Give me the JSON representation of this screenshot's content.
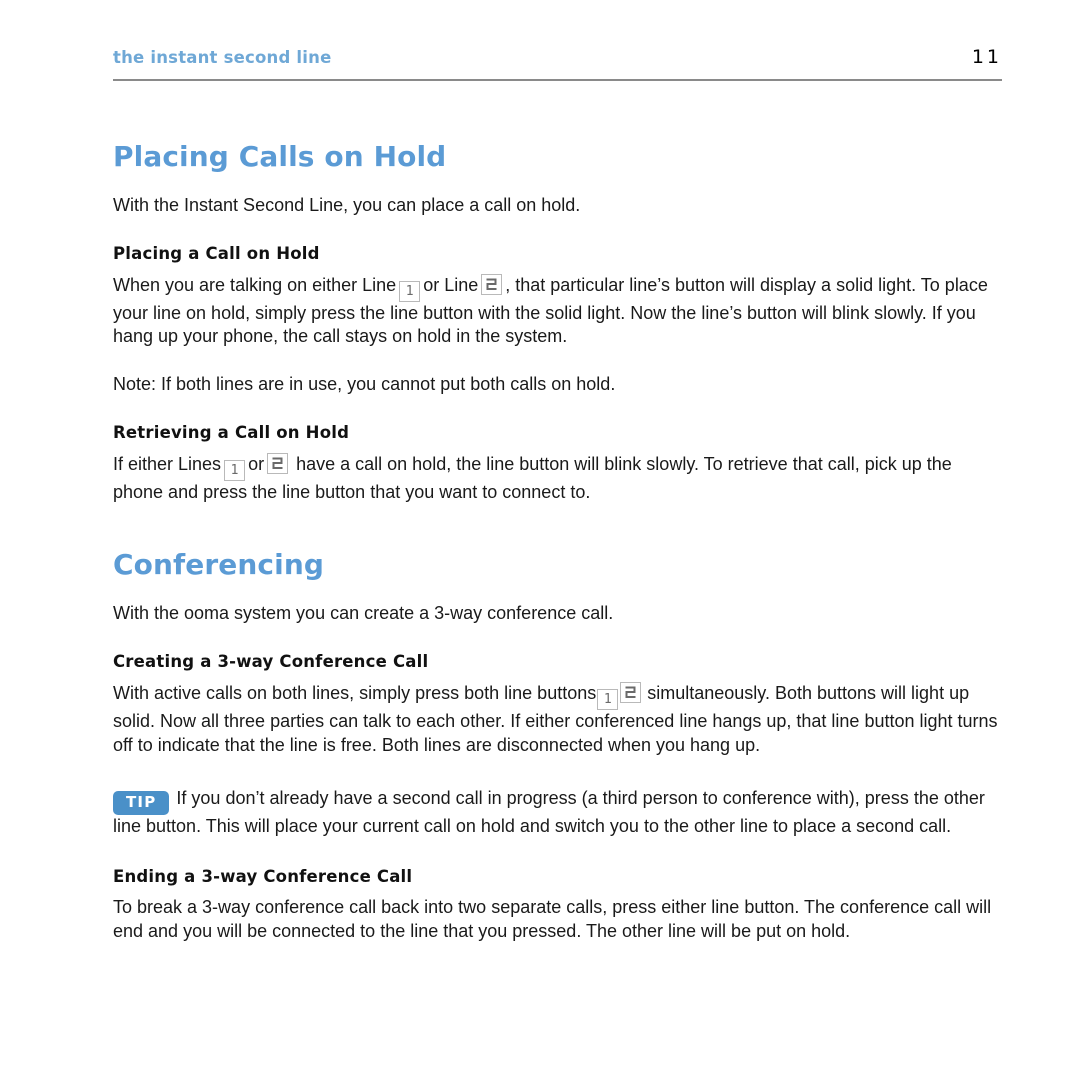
{
  "header": {
    "title": "the instant second line",
    "page_number": "11",
    "title_color": "#6fa8d6",
    "rule_color": "#8a8a8a"
  },
  "theme": {
    "heading_blue": "#5b9bd5",
    "tip_badge_blue": "#4a90c8",
    "body_black": "#1a1a1a",
    "line_button_border": "#b9b9b9",
    "line_button_digit": "#6a6a6a"
  },
  "sections": [
    {
      "title": "Placing Calls on Hold",
      "lead": "With the Instant Second Line, you can place a call on hold.",
      "subsections": [
        {
          "title": "Placing a Call on Hold",
          "para_1a": "When you are talking on either Line",
          "btn_1": "1",
          "para_1b": "or Line",
          "btn_2": "2",
          "para_1c": ", that particular line’s button will display a solid light. To place your line on hold, simply press the line button with the solid light. Now the line’s button will blink slowly. If you hang up your phone, the call stays on hold in the system.",
          "note": "Note: If both lines are in use, you cannot put both calls on hold."
        },
        {
          "title": "Retrieving a Call on Hold",
          "para_2a": "If either Lines",
          "btn_1": "1",
          "para_2b": "or",
          "btn_2": "2",
          "para_2c": "have a call on hold, the line button will blink slowly. To retrieve that call, pick up the phone and press the line button that you want to connect to."
        }
      ]
    },
    {
      "title": "Conferencing",
      "lead": "With the ooma system you can create a 3-way conference call.",
      "subsections": [
        {
          "title": "Creating a 3-way Conference Call",
          "para_3a": "With active calls on both lines, simply press both line buttons",
          "btn_1": "1",
          "btn_2": "2",
          "para_3b": "simultaneously. Both buttons will light up solid. Now all three parties can talk to each other. If either conferenced line hangs up, that line button light turns off to indicate that the line is free. Both lines are disconnected when you hang up."
        },
        {
          "title": "Ending a 3-way Conference Call",
          "para_4": "To break a 3-way conference call back into two separate calls, press either line button. The conference call will end and you will be connected to the line that you pressed. The other line will be put on hold."
        }
      ]
    }
  ],
  "tip": {
    "badge_label": "TIP",
    "text": "If you don’t already have a second call in progress (a third person to conference with), press the other line button. This will place your current call on hold and switch you to the other line to place a second call."
  }
}
